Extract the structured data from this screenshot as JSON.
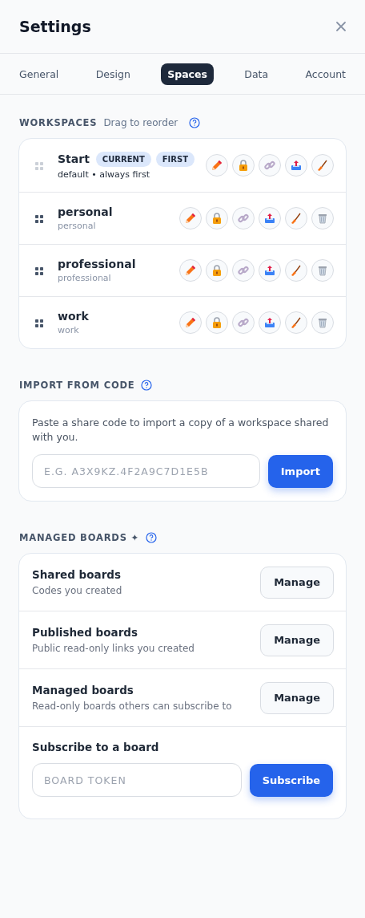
{
  "window": {
    "title": "Settings"
  },
  "tabs": [
    {
      "label": "General",
      "selected": false
    },
    {
      "label": "Design",
      "selected": false
    },
    {
      "label": "Spaces",
      "selected": true
    },
    {
      "label": "Data",
      "selected": false
    },
    {
      "label": "Account",
      "selected": false
    }
  ],
  "workspaces": {
    "heading": "WORKSPACES",
    "hint": "Drag to reorder",
    "items": [
      {
        "name": "Start",
        "badges": [
          "CURRENT",
          "FIRST"
        ],
        "subtitle": "default • always first",
        "pinned": true,
        "deletable": false
      },
      {
        "name": "personal",
        "subtitle": "personal",
        "pinned": false,
        "deletable": true
      },
      {
        "name": "professional",
        "subtitle": "professional",
        "pinned": false,
        "deletable": true
      },
      {
        "name": "work",
        "subtitle": "work",
        "pinned": false,
        "deletable": true
      }
    ]
  },
  "import": {
    "heading": "IMPORT FROM CODE",
    "description": "Paste a share code to import a copy of a workspace shared with you.",
    "placeholder": "E.G. A3X9KZ.4F2A9C7D1E5B",
    "button": "Import"
  },
  "managed": {
    "heading": "MANAGED BOARDS ✦",
    "rows": [
      {
        "title": "Shared boards",
        "subtitle": "Codes you created",
        "button": "Manage"
      },
      {
        "title": "Published boards",
        "subtitle": "Public read-only links you created",
        "button": "Manage"
      },
      {
        "title": "Managed boards",
        "subtitle": "Read-only boards others can subscribe to",
        "button": "Manage"
      }
    ],
    "subscribe": {
      "title": "Subscribe to a board",
      "placeholder": "BOARD TOKEN",
      "button": "Subscribe"
    }
  }
}
